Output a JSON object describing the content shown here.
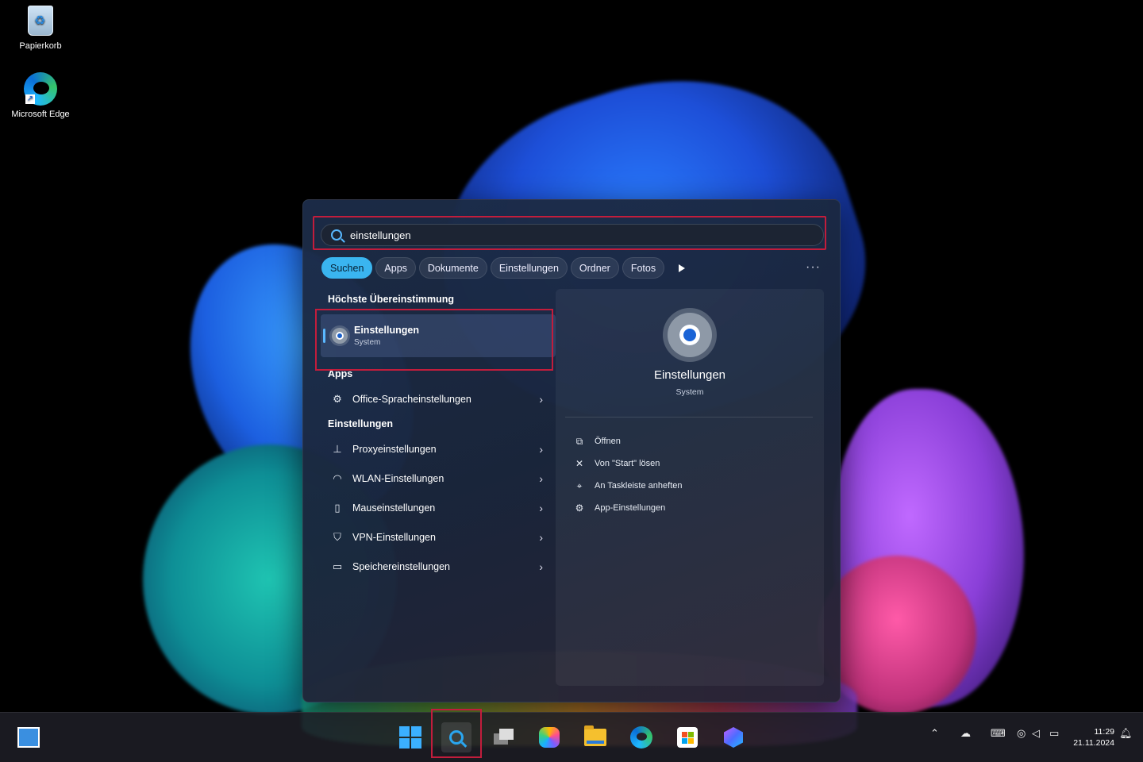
{
  "desktop": {
    "icons": [
      {
        "label": "Papierkorb",
        "icon": "recycle-bin-icon"
      },
      {
        "label": "Microsoft Edge",
        "icon": "edge-icon"
      }
    ]
  },
  "search": {
    "value": "einstellungen",
    "filters": [
      "Suchen",
      "Apps",
      "Dokumente",
      "Einstellungen",
      "Ordner",
      "Fotos"
    ],
    "active_filter": "Suchen",
    "more_label": "···"
  },
  "best_match": {
    "heading": "Höchste Übereinstimmung",
    "title": "Einstellungen",
    "subtitle": "System"
  },
  "apps": {
    "heading": "Apps",
    "items": [
      {
        "label": "Office-Spracheinstellungen",
        "icon": "language-settings-icon"
      }
    ]
  },
  "settings": {
    "heading": "Einstellungen",
    "items": [
      {
        "label": "Proxyeinstellungen",
        "icon": "proxy-icon"
      },
      {
        "label": "WLAN-Einstellungen",
        "icon": "wifi-icon"
      },
      {
        "label": "Mauseinstellungen",
        "icon": "mouse-icon"
      },
      {
        "label": "VPN-Einstellungen",
        "icon": "shield-icon"
      },
      {
        "label": "Speichereinstellungen",
        "icon": "storage-icon"
      }
    ]
  },
  "preview": {
    "title": "Einstellungen",
    "subtitle": "System",
    "actions": [
      {
        "label": "Öffnen",
        "icon": "open-icon"
      },
      {
        "label": "Von \"Start\" lösen",
        "icon": "unpin-icon"
      },
      {
        "label": "An Taskleiste anheften",
        "icon": "pin-icon"
      },
      {
        "label": "App-Einstellungen",
        "icon": "gear-icon"
      }
    ]
  },
  "taskbar": {
    "time": "11:29",
    "date": "21.11.2024"
  },
  "colors": {
    "accent": "#3ab5f0",
    "highlight": "#c21d3c"
  }
}
